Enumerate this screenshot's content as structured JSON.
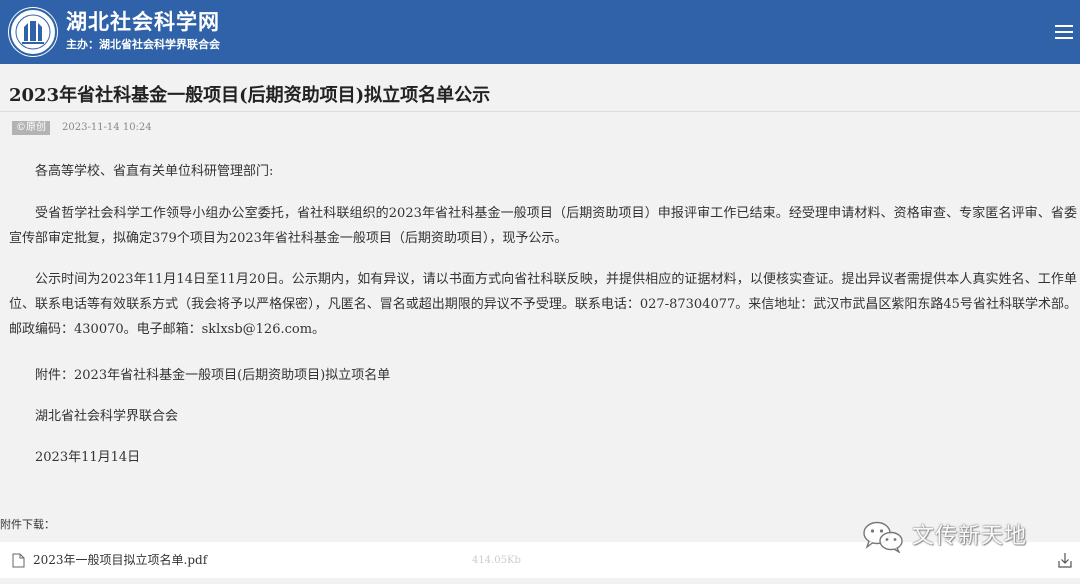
{
  "header": {
    "site_title": "湖北社会科学网",
    "site_subtitle": "主办：湖北省社会科学界联合会",
    "brand_color": "#2f62a8"
  },
  "article": {
    "title": "2023年省社科基金一般项目(后期资助项目)拟立项名单公示",
    "source_tag": "©原创",
    "date": "2023-11-14 10:24",
    "paragraphs": [
      "各高等学校、省直有关单位科研管理部门:",
      "受省哲学社会科学工作领导小组办公室委托，省社科联组织的2023年省社科基金一般项目（后期资助项目）申报评审工作已结束。经受理申请材料、资格审查、专家匿名评审、省委宣传部审定批复，拟确定379个项目为2023年省社科基金一般项目（后期资助项目），现予公示。",
      "公示时间为2023年11月14日至11月20日。公示期内，如有异议，请以书面方式向省社科联反映，并提供相应的证据材料，以便核实查证。提出异议者需提供本人真实姓名、工作单位、联系电话等有效联系方式（我会将予以严格保密），凡匿名、冒名或超出期限的异议不予受理。联系电话：027-87304077。来信地址：武汉市武昌区紫阳东路45号省社科联学术部。邮政编码：430070。电子邮箱：sklxsb@126.com。",
      "附件：2023年省社科基金一般项目(后期资助项目)拟立项名单",
      "湖北省社会科学界联合会",
      "2023年11月14日"
    ]
  },
  "attachments": {
    "label": "附件下载：",
    "files": [
      {
        "name": "2023年一般项目拟立项名单.pdf",
        "size": "414.05Kb"
      }
    ]
  },
  "watermark": {
    "text": "文传新天地",
    "icon": "wechat-icon"
  },
  "icons": {
    "menu": "menu-icon",
    "file": "file-icon",
    "download": "download-icon"
  }
}
